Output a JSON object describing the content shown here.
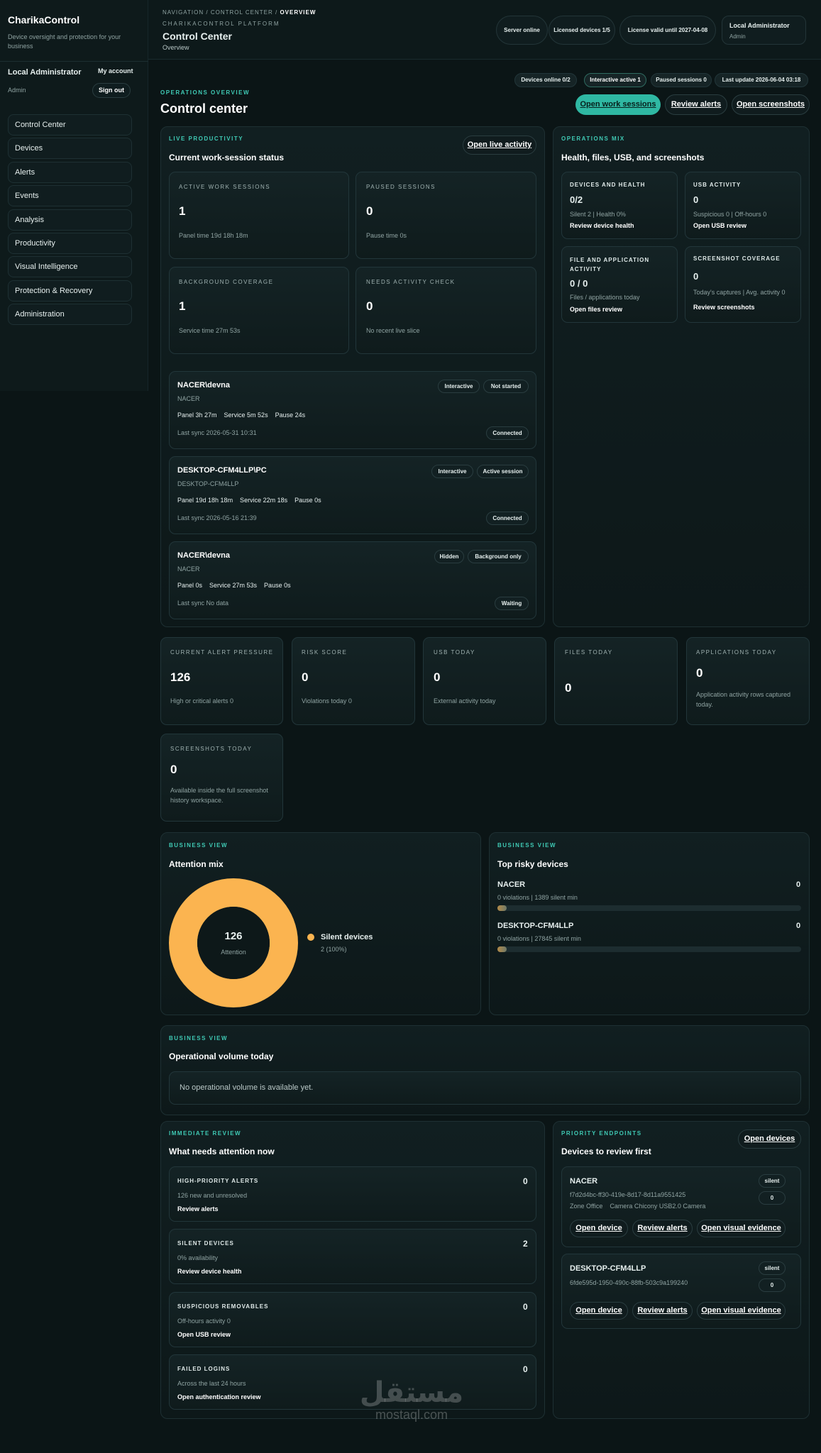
{
  "sidebar": {
    "brand": "CharikaControl",
    "tagline": "Device oversight and protection for your business",
    "user_name": "Local Administrator",
    "user_role": "Admin",
    "my_account": "My account",
    "sign_out": "Sign out",
    "nav": [
      "Control Center",
      "Devices",
      "Alerts",
      "Events",
      "Analysis",
      "Productivity",
      "Visual Intelligence",
      "Protection & Recovery",
      "Administration"
    ]
  },
  "topbar": {
    "crumb_navigation": "NAVIGATION",
    "crumb_control": "CONTROL CENTER",
    "crumb_current": "OVERVIEW",
    "platform": "CHARIKACONTROL PLATFORM",
    "title": "Control Center",
    "subtitle": "Overview",
    "server_status": "Server online",
    "licensed": "Licensed devices 1/5",
    "license_valid": "License valid until 2027-04-08",
    "admin_name": "Local Administrator",
    "admin_role": "Admin"
  },
  "status_chips": [
    "Devices online 0/2",
    "Interactive active 1",
    "Paused sessions 0",
    "Last update 2026-06-04 03:18"
  ],
  "page": {
    "kicker": "OPERATIONS OVERVIEW",
    "title": "Control center",
    "btn_sessions": "Open work sessions",
    "btn_alerts": "Review alerts",
    "btn_screenshots": "Open screenshots"
  },
  "live": {
    "kicker": "LIVE PRODUCTIVITY",
    "title": "Current work-session status",
    "open_live": "Open live activity",
    "cards": [
      {
        "label": "ACTIVE WORK SESSIONS",
        "value": "1",
        "note": "Panel time 19d 18h 18m"
      },
      {
        "label": "PAUSED SESSIONS",
        "value": "0",
        "note": "Pause time 0s"
      },
      {
        "label": "BACKGROUND COVERAGE",
        "value": "1",
        "note": "Service time 27m 53s"
      },
      {
        "label": "NEEDS ACTIVITY CHECK",
        "value": "0",
        "note": "No recent live slice"
      }
    ],
    "sessions": [
      {
        "name": "NACER\\devna",
        "host": "NACER",
        "times": "Panel 3h 27m    Service 5m 52s    Pause 24s",
        "sync": "Last sync 2026-05-31 10:31",
        "tag1": "Interactive",
        "tag2": "Not started",
        "status": "Connected"
      },
      {
        "name": "DESKTOP-CFM4LLP\\PC",
        "host": "DESKTOP-CFM4LLP",
        "times": "Panel 19d 18h 18m    Service 22m 18s    Pause 0s",
        "sync": "Last sync 2026-05-16 21:39",
        "tag1": "Interactive",
        "tag2": "Active session",
        "status": "Connected"
      },
      {
        "name": "NACER\\devna",
        "host": "NACER",
        "times": "Panel 0s    Service 27m 53s    Pause 0s",
        "sync": "Last sync No data",
        "tag1": "Hidden",
        "tag2": "Background only",
        "status": "Waiting"
      }
    ]
  },
  "ops_mix": {
    "kicker": "OPERATIONS MIX",
    "title": "Health, files, USB, and screenshots",
    "cards": [
      {
        "label": "DEVICES AND HEALTH",
        "value": "0/2",
        "note": "Silent 2 | Health 0%",
        "link": "Review device health"
      },
      {
        "label": "USB ACTIVITY",
        "value": "0",
        "note": "Suspicious 0 | Off-hours 0",
        "link": "Open USB review"
      },
      {
        "label": "FILE AND APPLICATION ACTIVITY",
        "value": "0 / 0",
        "note": "Files / applications today",
        "link": "Open files review"
      },
      {
        "label": "SCREENSHOT COVERAGE",
        "value": "0",
        "note": "Today's captures | Avg. activity 0",
        "link": "Review screenshots"
      }
    ]
  },
  "metrics": [
    {
      "label": "CURRENT ALERT PRESSURE",
      "value": "126",
      "note": "High or critical alerts 0"
    },
    {
      "label": "RISK SCORE",
      "value": "0",
      "note": "Violations today 0"
    },
    {
      "label": "USB TODAY",
      "value": "0",
      "note": "External activity today"
    },
    {
      "label": "FILES TODAY",
      "value": "0",
      "note": ""
    },
    {
      "label": "APPLICATIONS TODAY",
      "value": "0",
      "note": "Application activity rows captured today."
    },
    {
      "label": "SCREENSHOTS TODAY",
      "value": "0",
      "note": "Available inside the full screenshot history workspace."
    }
  ],
  "attention": {
    "kicker": "BUSINESS VIEW",
    "title": "Attention mix",
    "center_value": "126",
    "center_label": "Attention",
    "legend_name": "Silent devices",
    "legend_value": "2 (100%)",
    "color": "#fbb450"
  },
  "risky": {
    "kicker": "BUSINESS VIEW",
    "title": "Top risky devices",
    "devices": [
      {
        "name": "NACER",
        "score": "0",
        "detail": "0 violations | 1389 silent min",
        "fill": 0.03
      },
      {
        "name": "DESKTOP-CFM4LLP",
        "score": "0",
        "detail": "0 violations | 27845 silent min",
        "fill": 0.03
      }
    ]
  },
  "volume": {
    "kicker": "BUSINESS VIEW",
    "title": "Operational volume today",
    "empty": "No operational volume is available yet."
  },
  "review": {
    "kicker": "IMMEDIATE REVIEW",
    "title": "What needs attention now",
    "items": [
      {
        "label": "HIGH-PRIORITY ALERTS",
        "count": "0",
        "note": "126 new and unresolved",
        "link": "Review alerts"
      },
      {
        "label": "SILENT DEVICES",
        "count": "2",
        "note": "0% availability",
        "link": "Review device health"
      },
      {
        "label": "SUSPICIOUS REMOVABLES",
        "count": "0",
        "note": "Off-hours activity 0",
        "link": "Open USB review"
      },
      {
        "label": "FAILED LOGINS",
        "count": "0",
        "note": "Across the last 24 hours",
        "link": "Open authentication review"
      }
    ]
  },
  "endpoints": {
    "kicker": "PRIORITY ENDPOINTS",
    "title": "Devices to review first",
    "open_devices": "Open devices",
    "devices": [
      {
        "name": "NACER",
        "id": "f7d2d4bc-ff30-419e-8d17-8d11a9551425",
        "extra": "Zone Office    Camera Chicony USB2.0 Camera",
        "badge": "silent",
        "count": "0",
        "b1": "Open device",
        "b2": "Review alerts",
        "b3": "Open visual evidence"
      },
      {
        "name": "DESKTOP-CFM4LLP",
        "id": "6fde595d-1950-490c-88fb-503c9a199240",
        "extra": "",
        "badge": "silent",
        "count": "0",
        "b1": "Open device",
        "b2": "Review alerts",
        "b3": "Open visual evidence"
      }
    ]
  },
  "watermark": {
    "arabic": "مستقل",
    "latin": "mostaql.com"
  }
}
